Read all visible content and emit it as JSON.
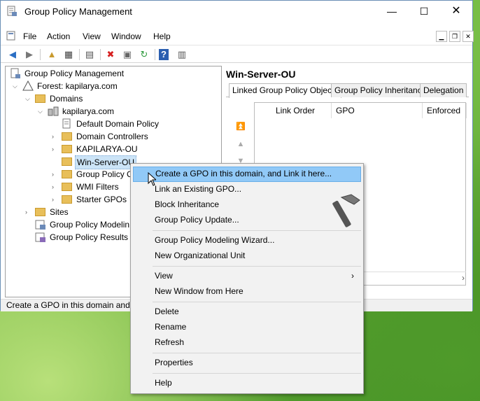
{
  "window": {
    "title": "Group Policy Management",
    "controls": {
      "minimize": "—",
      "maximize": "☐",
      "close": "✕"
    }
  },
  "menubar": {
    "items": [
      "File",
      "Action",
      "View",
      "Window",
      "Help"
    ]
  },
  "tree": {
    "root": "Group Policy Management",
    "forest": "Forest: kapilarya.com",
    "domains": "Domains",
    "domain": "kapilarya.com",
    "default_policy": "Default Domain Policy",
    "domain_controllers": "Domain Controllers",
    "kapilarya_ou": "KAPILARYA-OU",
    "win_server_ou": "Win-Server-OU",
    "group_policy_objects": "Group Policy C",
    "wmi_filters": "WMI Filters",
    "starter_gpos": "Starter GPOs",
    "sites": "Sites",
    "modeling": "Group Policy Modelin",
    "results": "Group Policy Results"
  },
  "details": {
    "ou_title": "Win-Server-OU",
    "tabs": [
      "Linked Group Policy Objects",
      "Group Policy Inheritance",
      "Delegation"
    ],
    "columns": [
      "Link Order",
      "GPO",
      "Enforced"
    ]
  },
  "status": {
    "text": "Create a GPO in this domain and l"
  },
  "context_menu": {
    "items": [
      "Create a GPO in this domain, and Link it here...",
      "Link an Existing GPO...",
      "Block Inheritance",
      "Group Policy Update...",
      "Group Policy Modeling Wizard...",
      "New Organizational Unit",
      "View",
      "New Window from Here",
      "Delete",
      "Rename",
      "Refresh",
      "Properties",
      "Help"
    ],
    "submenu_arrow": "›"
  },
  "colors": {
    "highlight": "#91c9f7",
    "selection": "#cce4f7",
    "folder": "#e8bf5a"
  }
}
